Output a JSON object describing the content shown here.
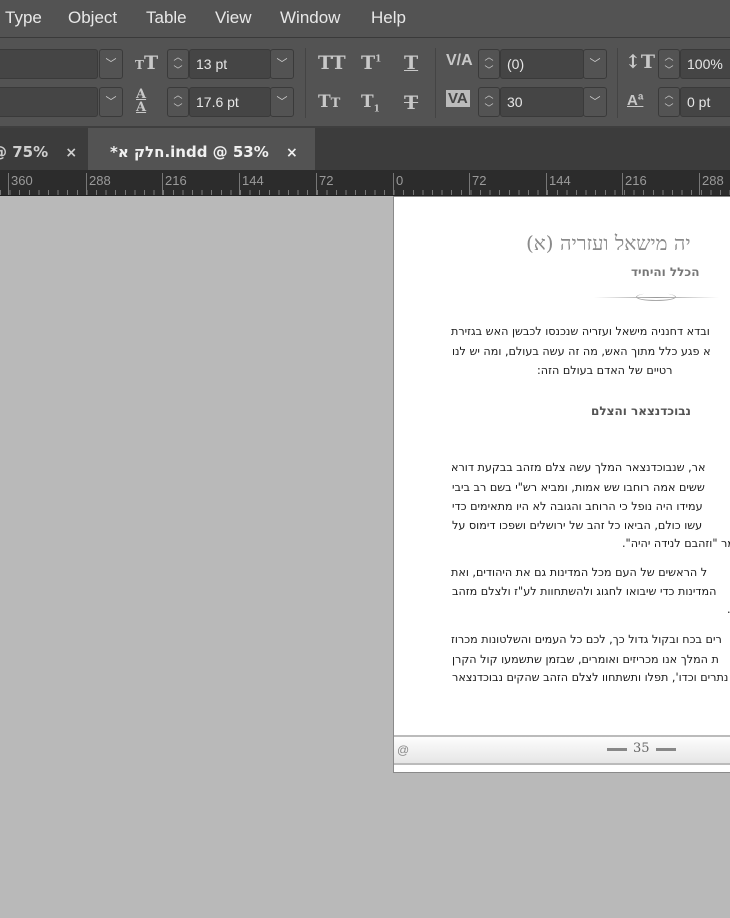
{
  "menu": [
    "Type",
    "Object",
    "Table",
    "View",
    "Window",
    "Help"
  ],
  "toolbar": {
    "font_size": "13 pt",
    "leading": "17.6 pt",
    "kerning": "(0)",
    "tracking": "30",
    "vertical_scale": "100%",
    "baseline_shift": "0 pt",
    "icons": [
      "font-size-icon",
      "leading-icon",
      "all-caps-icon",
      "superscript-icon",
      "underline-icon",
      "small-caps-icon",
      "subscript-icon",
      "strikethrough-icon",
      "kerning-icon",
      "tracking-icon",
      "vertical-scale-icon",
      "baseline-shift-icon"
    ]
  },
  "tabs": [
    {
      "label": "@ 75%",
      "close": "×"
    },
    {
      "label": "*חלק א.indd @ 53%",
      "close": "×"
    }
  ],
  "ruler": [
    "360",
    "288",
    "216",
    "144",
    "72",
    "0",
    "72",
    "144",
    "216",
    "288"
  ],
  "document": {
    "title": "יה מישאל ועזריה (א)",
    "subtitle": "הכלל והיחיד",
    "heading": "נבוכדנצאר והצלם",
    "lines": [
      "ובדא דחנניה מישאל ועזריה שנכנסו לכבשן האש בגזירת",
      "א פגע כלל מתוך האש, מה זה עשה בעולם, ומה יש לנו",
      "רטיים של האדם בעולם הזה:",
      "אר, שנבוכדנצאר המלך עשה צלם מזהב בבקעת דורא",
      "ששים אמה רוחבו שש אמות, ומביא רש\"י בשם רב ביבי",
      "עמידו היה נופל כי הרוחב והגובה לא היו מתאימים כדי",
      "עשו כולם, הביאו כל זהב של ירושלים ושפכו דימוס על",
      "מר \"וזהבם לנידה יהיה\".",
      "ל הראשים של העם מכל המדינות גם את היהודים, ואת",
      "המדינות כדי שיבואו לחגוג ולהשתחוות לע\"ז ולצלם מזהב",
      ".",
      "רים בכח ובקול גדול כך, לכם כל העמים והשלטונות מכרוז",
      "ת המלך אנו מכריזים ואומרים, שבזמן שתשמעו קול הקרן",
      "נתרים וכדו', תפלו ותשתחוו לצלם הזהב שהקים נבוכדנצאר"
    ],
    "page_number": "35"
  }
}
